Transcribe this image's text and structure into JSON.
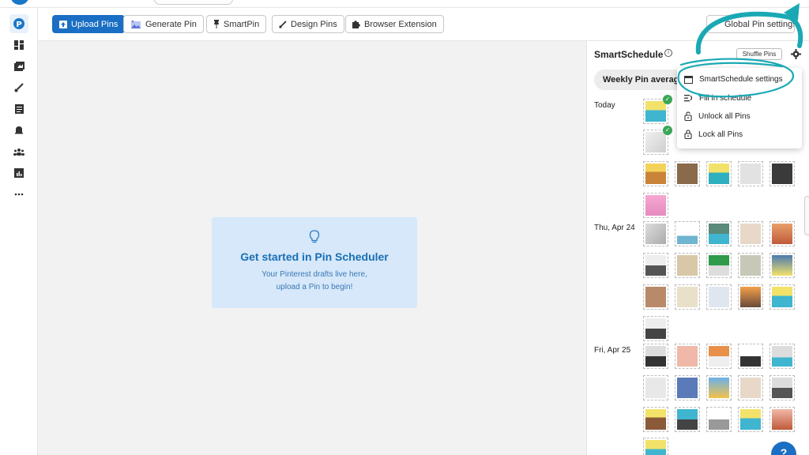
{
  "toolbar": {
    "upload_label": "Upload Pins",
    "generate_label": "Generate Pin",
    "smartpin_label": "SmartPin",
    "design_label": "Design Pins",
    "extension_label": "Browser Extension",
    "global_settings_label": "Global Pin settings"
  },
  "rail": {
    "items": [
      "pinterest-logo-icon",
      "dashboard-icon",
      "gallery-icon",
      "brush-icon",
      "document-icon",
      "bell-icon",
      "people-icon",
      "analytics-icon",
      "more-icon"
    ]
  },
  "empty_state": {
    "title": "Get started in Pin Scheduler",
    "line1": "Your Pinterest drafts live here,",
    "line2": "upload a Pin to begin!"
  },
  "panel": {
    "title": "SmartSchedule",
    "shuffle_label": "Shuffle Pins",
    "weekly_label": "Weekly Pin average",
    "days": [
      {
        "label": "Today"
      },
      {
        "label": "Thu, Apr 24"
      },
      {
        "label": "Fri, Apr 25"
      }
    ]
  },
  "menu": {
    "items": [
      {
        "label": "SmartSchedule settings",
        "icon": "calendar-icon"
      },
      {
        "label": "Fill in schedule",
        "icon": "fill-icon"
      },
      {
        "label": "Unlock all Pins",
        "icon": "unlock-icon"
      },
      {
        "label": "Lock all Pins",
        "icon": "lock-icon"
      }
    ]
  },
  "help_label": "?",
  "colors": {
    "primary": "#1a6fc4",
    "annotation": "#1aa9b4",
    "card_bg": "#d6e8f9",
    "check": "#3aa757"
  }
}
